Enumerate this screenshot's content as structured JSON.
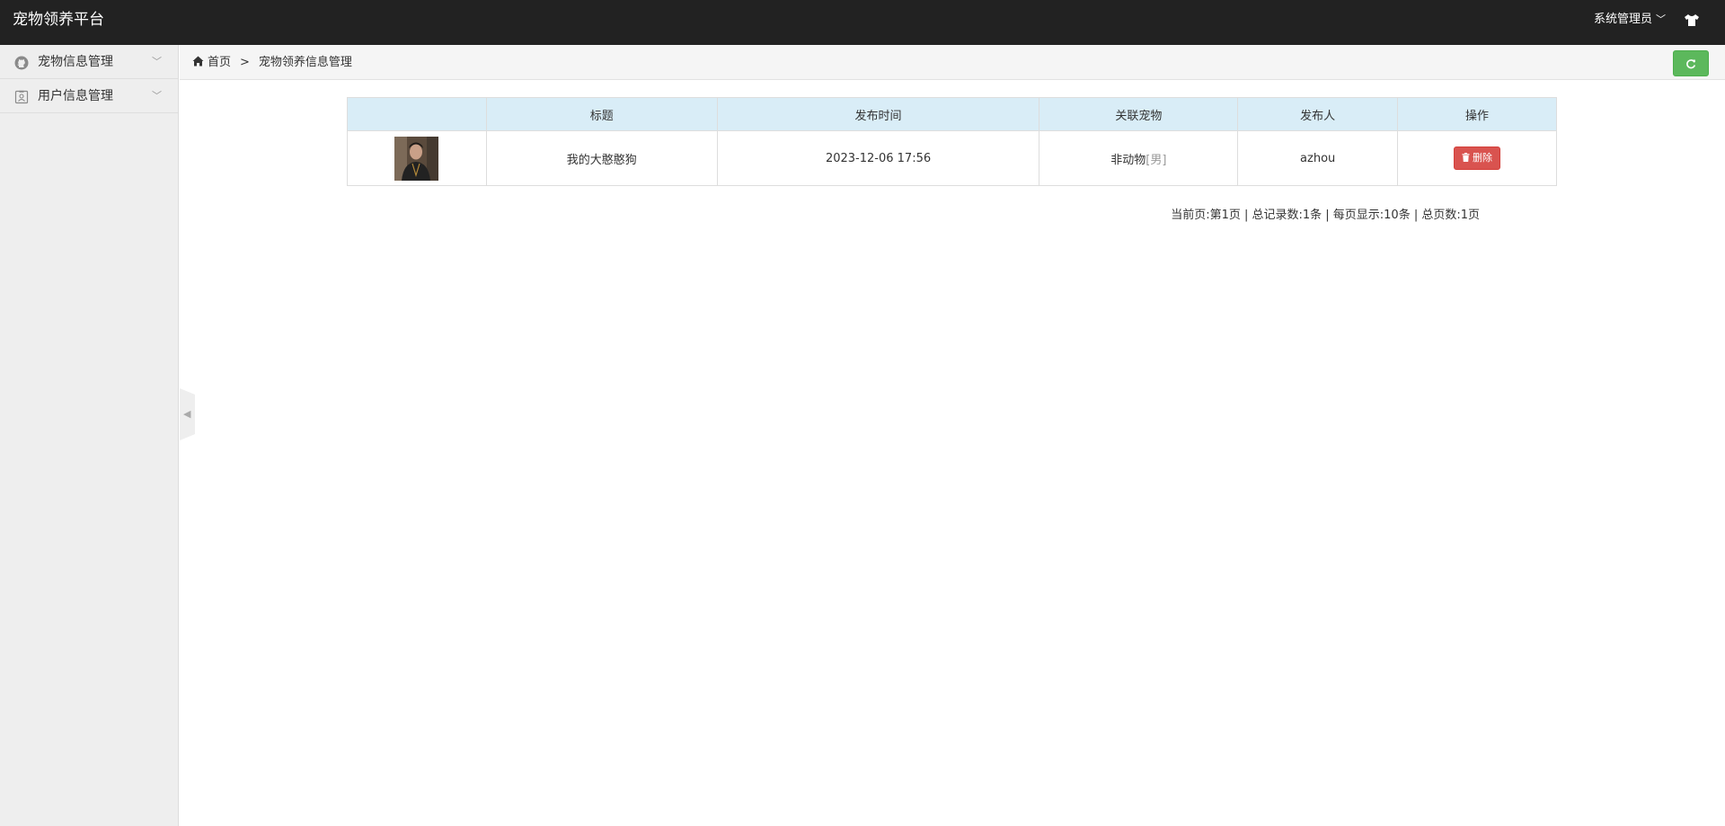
{
  "app": {
    "title": "宠物领养平台",
    "user_label": "系统管理员"
  },
  "sidebar": {
    "items": [
      {
        "label": "宠物信息管理",
        "icon": "github-icon"
      },
      {
        "label": "用户信息管理",
        "icon": "user-card-icon"
      }
    ]
  },
  "breadcrumb": {
    "home": "首页",
    "separator": ">",
    "current": "宠物领养信息管理"
  },
  "table": {
    "headers": [
      "",
      "标题",
      "发布时间",
      "关联宠物",
      "发布人",
      "操作"
    ],
    "rows": [
      {
        "title": "我的大憨憨狗",
        "time": "2023-12-06 17:56",
        "pet_name": "非动物",
        "pet_gender": "[男]",
        "publisher": "azhou",
        "action": "删除"
      }
    ]
  },
  "pagination": {
    "text": "当前页:第1页 | 总记录数:1条 | 每页显示:10条 | 总页数:1页"
  },
  "colors": {
    "topbar": "#222222",
    "sidebar": "#eeeeee",
    "table_header": "#d9edf7",
    "refresh_button": "#5cb85c",
    "delete_button": "#d9534f"
  }
}
